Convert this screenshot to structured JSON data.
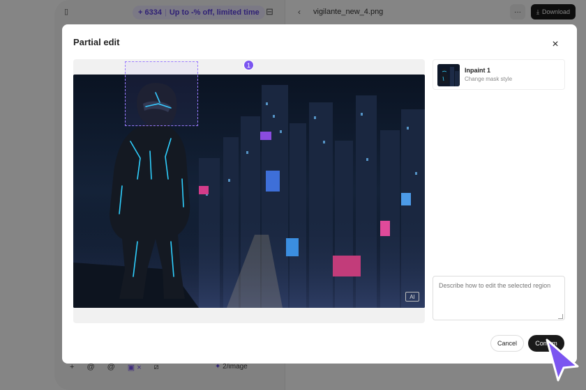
{
  "background_app": {
    "promo_credits": "+ 6334",
    "promo_text": "Up to -% off, limited time",
    "file_title": "vigilante_new_4.png",
    "more_label": "···",
    "download_label": "Download",
    "bottom_tools": [
      "+",
      "@",
      "@",
      "▣ ×",
      "⧄"
    ],
    "rate_label": "2/image"
  },
  "modal": {
    "title": "Partial edit",
    "close_icon": "×",
    "mask_number": "1",
    "ai_badge": "AI",
    "inpaint": {
      "title": "Inpaint 1",
      "subtitle": "Change mask style"
    },
    "prompt": {
      "placeholder": "Describe how to edit the selected region"
    },
    "cancel_label": "Cancel",
    "confirm_label": "Confirm"
  },
  "colors": {
    "accent": "#7b55f0",
    "primary_button": "#1a1a1a",
    "cursor": "#7b55f0"
  }
}
